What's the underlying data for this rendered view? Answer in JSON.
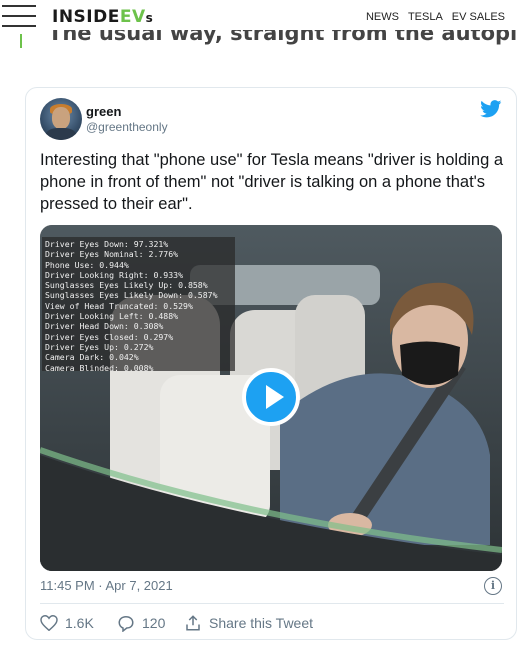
{
  "site": {
    "logo_main": "INSIDE",
    "logo_ev": "EV",
    "logo_s": "s",
    "nav": [
      "NEWS",
      "TESLA",
      "EV SALES"
    ],
    "scrolled_text": "The usual way, straight from the autopilot computer"
  },
  "tweet": {
    "user_name": "green",
    "user_handle": "@greentheonly",
    "text": "Interesting that \"phone use\" for Tesla means \"driver is holding a phone in front of them\" not \"driver is talking on a phone that's pressed to their ear\".",
    "overlay_lines": [
      "Driver Eyes Down: 97.321%",
      "Driver Eyes Nominal: 2.776%",
      "Phone Use: 0.944%",
      "Driver Looking Right: 0.933%",
      "Sunglasses Eyes Likely Up: 0.858%",
      "Sunglasses Eyes Likely Down: 0.587%",
      "View of Head Truncated: 0.529%",
      "Driver Looking Left: 0.488%",
      "Driver Head Down: 0.308%",
      "Driver Eyes Closed: 0.297%",
      "Driver Eyes Up: 0.272%",
      "Camera Dark: 0.042%",
      "Camera Blinded: 0.008%"
    ],
    "timestamp": "11:45 PM · Apr 7, 2021",
    "likes": "1.6K",
    "replies": "120",
    "share_label": "Share this Tweet"
  },
  "colors": {
    "brand_green": "#6dc24b",
    "twitter_blue": "#1da1f2",
    "muted": "#657786"
  },
  "icons": [
    "hamburger-menu-icon",
    "twitter-bird-icon",
    "play-icon",
    "info-icon",
    "heart-icon",
    "reply-icon",
    "share-icon"
  ]
}
